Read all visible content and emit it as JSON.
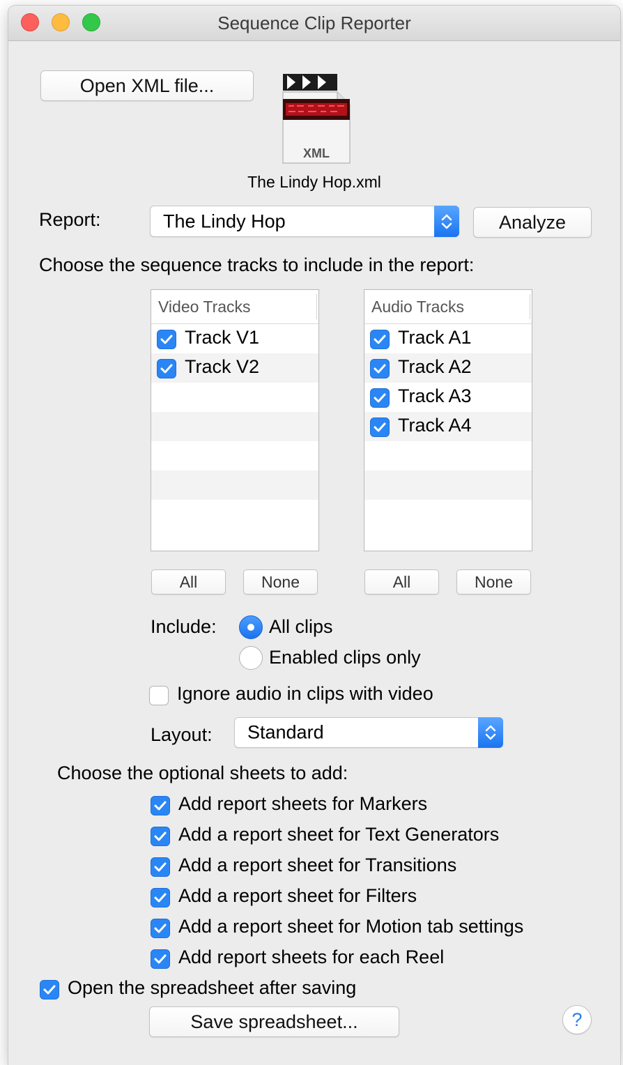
{
  "window": {
    "title": "Sequence Clip Reporter"
  },
  "file": {
    "open_button": "Open XML file...",
    "icon_label": "XML",
    "filename": "The Lindy Hop.xml"
  },
  "report": {
    "label": "Report:",
    "selected": "The Lindy Hop",
    "analyze_button": "Analyze"
  },
  "tracks": {
    "instruction": "Choose the sequence tracks to include in the report:",
    "video": {
      "header": "Video Tracks",
      "items": [
        {
          "label": "Track V1",
          "checked": true
        },
        {
          "label": "Track V2",
          "checked": true
        }
      ],
      "all_button": "All",
      "none_button": "None"
    },
    "audio": {
      "header": "Audio Tracks",
      "items": [
        {
          "label": "Track A1",
          "checked": true
        },
        {
          "label": "Track A2",
          "checked": true
        },
        {
          "label": "Track A3",
          "checked": true
        },
        {
          "label": "Track A4",
          "checked": true
        }
      ],
      "all_button": "All",
      "none_button": "None"
    }
  },
  "include": {
    "label": "Include:",
    "options": [
      {
        "label": "All clips",
        "selected": true
      },
      {
        "label": "Enabled clips only",
        "selected": false
      }
    ]
  },
  "ignore_audio": {
    "label": "Ignore audio in clips with video",
    "checked": false
  },
  "layout": {
    "label": "Layout:",
    "selected": "Standard"
  },
  "sheets": {
    "instruction": "Choose the optional sheets to add:",
    "items": [
      {
        "label": "Add report sheets for Markers",
        "checked": true
      },
      {
        "label": "Add a report sheet for Text Generators",
        "checked": true
      },
      {
        "label": "Add a report sheet for Transitions",
        "checked": true
      },
      {
        "label": "Add a report sheet for Filters",
        "checked": true
      },
      {
        "label": "Add a report sheet for Motion tab settings",
        "checked": true
      },
      {
        "label": "Add report sheets for each Reel",
        "checked": true
      }
    ]
  },
  "open_after": {
    "label": "Open the spreadsheet after saving",
    "checked": true
  },
  "save_button": "Save spreadsheet...",
  "help_button": "?",
  "colors": {
    "accent": "#2a86f4",
    "window_bg": "#ececec"
  },
  "icons": [
    "close-light",
    "minimize-light",
    "zoom-light",
    "xml-file-icon",
    "popup-stepper-icon",
    "checkmark-icon",
    "help-icon"
  ]
}
